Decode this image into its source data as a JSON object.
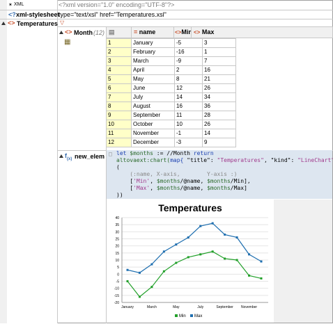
{
  "rows": {
    "xml": {
      "label": "XML",
      "value": "<?xml version=\"1.0\" encoding=\"UTF-8\"?>"
    },
    "stylesheet": {
      "label": "xml-stylesheet",
      "value": "type=\"text/xsl\" href=\"Temperatures.xsl\""
    },
    "temperatures": {
      "label": "Temperatures"
    },
    "month": {
      "label": "Month",
      "count": "(12)"
    },
    "new_elem": {
      "label": "new_elem"
    }
  },
  "table": {
    "headers": {
      "name": "name",
      "min": "Min",
      "max": "Max"
    },
    "rows": [
      {
        "i": "1",
        "name": "January",
        "min": "-5",
        "max": "3"
      },
      {
        "i": "2",
        "name": "February",
        "min": "-16",
        "max": "1"
      },
      {
        "i": "3",
        "name": "March",
        "min": "-9",
        "max": "7"
      },
      {
        "i": "4",
        "name": "April",
        "min": "2",
        "max": "16"
      },
      {
        "i": "5",
        "name": "May",
        "min": "8",
        "max": "21"
      },
      {
        "i": "6",
        "name": "June",
        "min": "12",
        "max": "26"
      },
      {
        "i": "7",
        "name": "July",
        "min": "14",
        "max": "34"
      },
      {
        "i": "8",
        "name": "August",
        "min": "16",
        "max": "36"
      },
      {
        "i": "9",
        "name": "September",
        "min": "11",
        "max": "28"
      },
      {
        "i": "10",
        "name": "October",
        "min": "10",
        "max": "26"
      },
      {
        "i": "11",
        "name": "November",
        "min": "-1",
        "max": "14"
      },
      {
        "i": "12",
        "name": "December",
        "min": "-3",
        "max": "9"
      }
    ]
  },
  "code": {
    "line1_a": "let ",
    "line1_b": "$months",
    "line1_c": " := //Month ",
    "line1_d": "return",
    "line2_a": "altovaext:chart(",
    "line2_b": "map{",
    "line2_c": " \"title\": ",
    "line2_d": "\"Temperatures\"",
    "line2_e": ", \"kind\": ",
    "line2_f": "\"LineChart\"",
    "line2_g": " },",
    "line3": "(",
    "line4": "    (:name, X-axis,        Y-axis :)",
    "line5_a": "    [",
    "line5_b": "'Min'",
    "line5_c": ", ",
    "line5_d": "$months",
    "line5_e": "/@name, ",
    "line5_f": "$months",
    "line5_g": "/Min],",
    "line6_a": "    [",
    "line6_b": "'Max'",
    "line6_c": ", ",
    "line6_d": "$months",
    "line6_e": "/@name, ",
    "line6_f": "$months",
    "line6_g": "/Max]",
    "line7": "))"
  },
  "chart_data": {
    "type": "line",
    "title": "Temperatures",
    "categories": [
      "January",
      "February",
      "March",
      "April",
      "May",
      "June",
      "July",
      "August",
      "September",
      "October",
      "November",
      "December"
    ],
    "x_tick_labels": [
      "January",
      "March",
      "May",
      "July",
      "September",
      "November"
    ],
    "y_ticks": [
      "40",
      "35",
      "30",
      "25",
      "20",
      "15",
      "10",
      "5",
      "0",
      "-5",
      "-10",
      "-15",
      "-20"
    ],
    "ylim": [
      -20,
      40
    ],
    "series": [
      {
        "name": "Min",
        "color": "#22a02a",
        "values": [
          -5,
          -16,
          -9,
          2,
          8,
          12,
          14,
          16,
          11,
          10,
          -1,
          -3
        ]
      },
      {
        "name": "Max",
        "color": "#1f6fb0",
        "values": [
          3,
          1,
          7,
          16,
          21,
          26,
          34,
          36,
          28,
          26,
          14,
          9
        ]
      }
    ],
    "legend": "bottom",
    "grid": true
  }
}
